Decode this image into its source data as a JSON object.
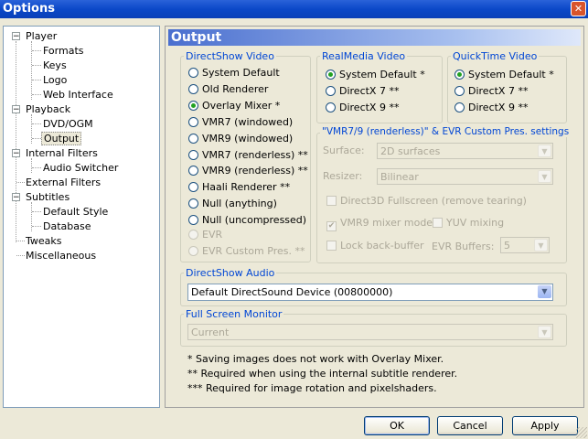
{
  "window": {
    "title": "Options",
    "close_symbol": "✕"
  },
  "tree": {
    "items": [
      {
        "label": "Player",
        "level": 0,
        "expander": "−"
      },
      {
        "label": "Formats",
        "level": 1
      },
      {
        "label": "Keys",
        "level": 1
      },
      {
        "label": "Logo",
        "level": 1
      },
      {
        "label": "Web Interface",
        "level": 1
      },
      {
        "label": "Playback",
        "level": 0,
        "expander": "−"
      },
      {
        "label": "DVD/OGM",
        "level": 1
      },
      {
        "label": "Output",
        "level": 1,
        "selected": true
      },
      {
        "label": "Internal Filters",
        "level": 0,
        "expander": "−"
      },
      {
        "label": "Audio Switcher",
        "level": 1
      },
      {
        "label": "External Filters",
        "level": 0
      },
      {
        "label": "Subtitles",
        "level": 0,
        "expander": "−"
      },
      {
        "label": "Default Style",
        "level": 1
      },
      {
        "label": "Database",
        "level": 1
      },
      {
        "label": "Tweaks",
        "level": 0
      },
      {
        "label": "Miscellaneous",
        "level": 0
      }
    ]
  },
  "panel": {
    "title": "Output"
  },
  "directshow_video": {
    "label": "DirectShow Video",
    "options": [
      {
        "label": "System Default",
        "checked": false,
        "enabled": true
      },
      {
        "label": "Old Renderer",
        "checked": false,
        "enabled": true
      },
      {
        "label": "Overlay Mixer *",
        "checked": true,
        "enabled": true
      },
      {
        "label": "VMR7 (windowed)",
        "checked": false,
        "enabled": true
      },
      {
        "label": "VMR9 (windowed)",
        "checked": false,
        "enabled": true
      },
      {
        "label": "VMR7 (renderless) **",
        "checked": false,
        "enabled": true
      },
      {
        "label": "VMR9 (renderless) **",
        "checked": false,
        "enabled": true
      },
      {
        "label": "Haali Renderer **",
        "checked": false,
        "enabled": true
      },
      {
        "label": "Null (anything)",
        "checked": false,
        "enabled": true
      },
      {
        "label": "Null (uncompressed)",
        "checked": false,
        "enabled": true
      },
      {
        "label": "EVR",
        "checked": false,
        "enabled": false
      },
      {
        "label": "EVR Custom Pres. **",
        "checked": false,
        "enabled": false
      }
    ]
  },
  "realmedia_video": {
    "label": "RealMedia Video",
    "options": [
      {
        "label": "System Default *",
        "checked": true
      },
      {
        "label": "DirectX 7 **",
        "checked": false
      },
      {
        "label": "DirectX 9 **",
        "checked": false
      }
    ]
  },
  "quicktime_video": {
    "label": "QuickTime Video",
    "options": [
      {
        "label": "System Default *",
        "checked": true
      },
      {
        "label": "DirectX 7 **",
        "checked": false
      },
      {
        "label": "DirectX 9 **",
        "checked": false
      }
    ]
  },
  "vmr_settings": {
    "label": "\"VMR7/9 (renderless)\" & EVR Custom Pres. settings",
    "surface_label": "Surface:",
    "surface_value": "2D surfaces",
    "resizer_label": "Resizer:",
    "resizer_value": "Bilinear",
    "d3d_fullscreen": "Direct3D Fullscreen (remove tearing)",
    "vmr9_mixer": "VMR9 mixer mode",
    "vmr9_mixer_checked": true,
    "yuv_mixing": "YUV mixing",
    "lock_back_buffer": "Lock back-buffer",
    "evr_buffers_label": "EVR Buffers:",
    "evr_buffers_value": "5"
  },
  "directshow_audio": {
    "label": "DirectShow Audio",
    "device": "Default DirectSound Device (00800000)"
  },
  "fullscreen_monitor": {
    "label": "Full Screen Monitor",
    "value": "Current"
  },
  "notes": [
    "* Saving images does not work with Overlay Mixer.",
    "** Required when using the internal subtitle renderer.",
    "*** Required for image rotation and pixelshaders."
  ],
  "buttons": {
    "ok": "OK",
    "cancel": "Cancel",
    "apply": "Apply"
  },
  "icons": {
    "close": "close-icon",
    "dropdown": "chevron-down-icon",
    "tree_collapse": "minus-box-icon",
    "checkmark": "checkmark-icon"
  },
  "colors": {
    "titlebar": "#0b48c8",
    "group_label": "#0046d5",
    "radio_checked": "#21a121",
    "disabled_text": "#aca899"
  }
}
